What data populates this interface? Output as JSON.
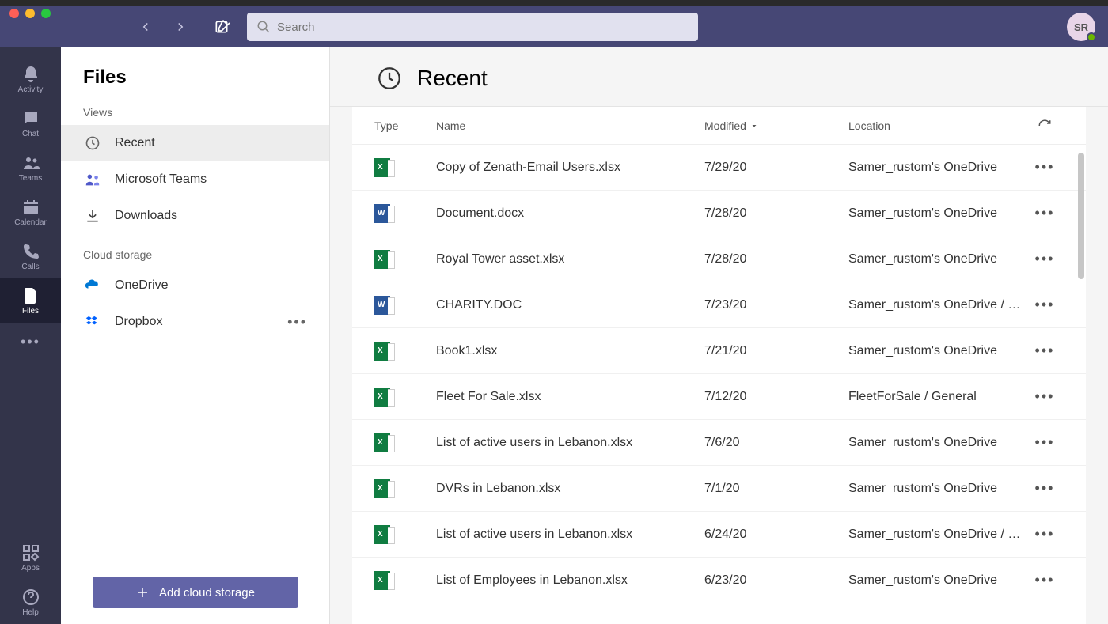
{
  "window": {
    "search_placeholder": "Search",
    "avatar_initials": "SR"
  },
  "rail": {
    "items": [
      {
        "id": "activity",
        "label": "Activity"
      },
      {
        "id": "chat",
        "label": "Chat"
      },
      {
        "id": "teams",
        "label": "Teams"
      },
      {
        "id": "calendar",
        "label": "Calendar"
      },
      {
        "id": "calls",
        "label": "Calls"
      },
      {
        "id": "files",
        "label": "Files"
      }
    ],
    "apps_label": "Apps",
    "help_label": "Help"
  },
  "sidebar": {
    "title": "Files",
    "views_label": "Views",
    "views": [
      {
        "id": "recent",
        "label": "Recent",
        "active": true
      },
      {
        "id": "msteams",
        "label": "Microsoft Teams"
      },
      {
        "id": "downloads",
        "label": "Downloads"
      }
    ],
    "cloud_label": "Cloud storage",
    "cloud": [
      {
        "id": "onedrive",
        "label": "OneDrive"
      },
      {
        "id": "dropbox",
        "label": "Dropbox",
        "more": true
      }
    ],
    "add_storage_label": "Add cloud storage"
  },
  "content": {
    "title": "Recent",
    "columns": {
      "type": "Type",
      "name": "Name",
      "modified": "Modified",
      "location": "Location"
    },
    "files": [
      {
        "type": "excel",
        "name": "Copy of Zenath-Email Users.xlsx",
        "modified": "7/29/20",
        "location": "Samer_rustom's OneDrive"
      },
      {
        "type": "word",
        "name": "Document.docx",
        "modified": "7/28/20",
        "location": "Samer_rustom's OneDrive"
      },
      {
        "type": "excel",
        "name": "Royal Tower asset.xlsx",
        "modified": "7/28/20",
        "location": "Samer_rustom's OneDrive"
      },
      {
        "type": "word",
        "name": "CHARITY.DOC",
        "modified": "7/23/20",
        "location": "Samer_rustom's OneDrive / …"
      },
      {
        "type": "excel",
        "name": "Book1.xlsx",
        "modified": "7/21/20",
        "location": "Samer_rustom's OneDrive"
      },
      {
        "type": "excel",
        "name": "Fleet For Sale.xlsx",
        "modified": "7/12/20",
        "location": "FleetForSale / General"
      },
      {
        "type": "excel",
        "name": "List of active users in Lebanon.xlsx",
        "modified": "7/6/20",
        "location": "Samer_rustom's OneDrive"
      },
      {
        "type": "excel",
        "name": "DVRs in Lebanon.xlsx",
        "modified": "7/1/20",
        "location": "Samer_rustom's OneDrive"
      },
      {
        "type": "excel",
        "name": "List of active users in Lebanon.xlsx",
        "modified": "6/24/20",
        "location": "Samer_rustom's OneDrive / …"
      },
      {
        "type": "excel",
        "name": "List of Employees in Lebanon.xlsx",
        "modified": "6/23/20",
        "location": "Samer_rustom's OneDrive"
      }
    ]
  }
}
